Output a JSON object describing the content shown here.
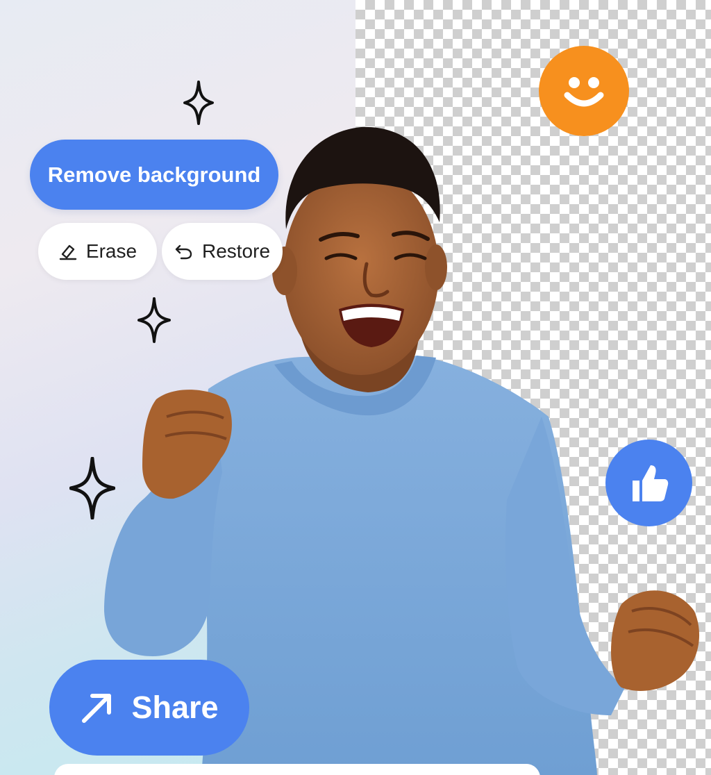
{
  "toolbar": {
    "remove_background_label": "Remove background",
    "erase_label": "Erase",
    "restore_label": "Restore",
    "share_label": "Share"
  },
  "icons": {
    "erase": "pencil-eraser-icon",
    "restore": "undo-arrow-icon",
    "share": "arrow-up-right-icon",
    "smiley": "smiley-face-icon",
    "thumbs_up": "thumbs-up-icon",
    "sparkle": "sparkle-icon"
  },
  "colors": {
    "accent_blue": "#4b82ef",
    "smiley_orange": "#f7901e",
    "sweater_blue": "#7aa7d9"
  }
}
